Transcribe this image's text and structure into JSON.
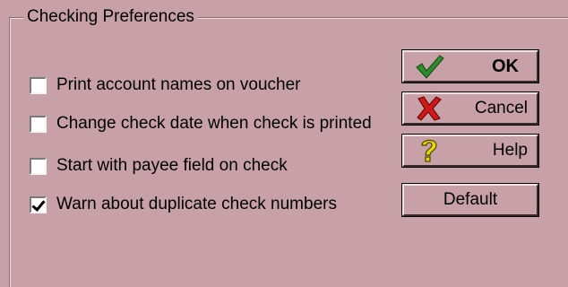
{
  "group": {
    "title": "Checking Preferences"
  },
  "preferences": [
    {
      "label": "Print account names on voucher",
      "checked": false
    },
    {
      "label": "Change check date when check is printed",
      "checked": false
    },
    {
      "label": "Start with payee field on check",
      "checked": false
    },
    {
      "label": "Warn about duplicate check numbers",
      "checked": true
    }
  ],
  "buttons": {
    "ok": {
      "label": "OK",
      "icon": "check-icon",
      "color": "#2e8b2e"
    },
    "cancel": {
      "label": "Cancel",
      "icon": "x-icon",
      "color": "#d01818"
    },
    "help": {
      "label": "Help",
      "icon": "question-icon",
      "color": "#e6d800"
    },
    "default": {
      "label": "Default"
    }
  },
  "colors": {
    "background": "#c8a0a8"
  }
}
